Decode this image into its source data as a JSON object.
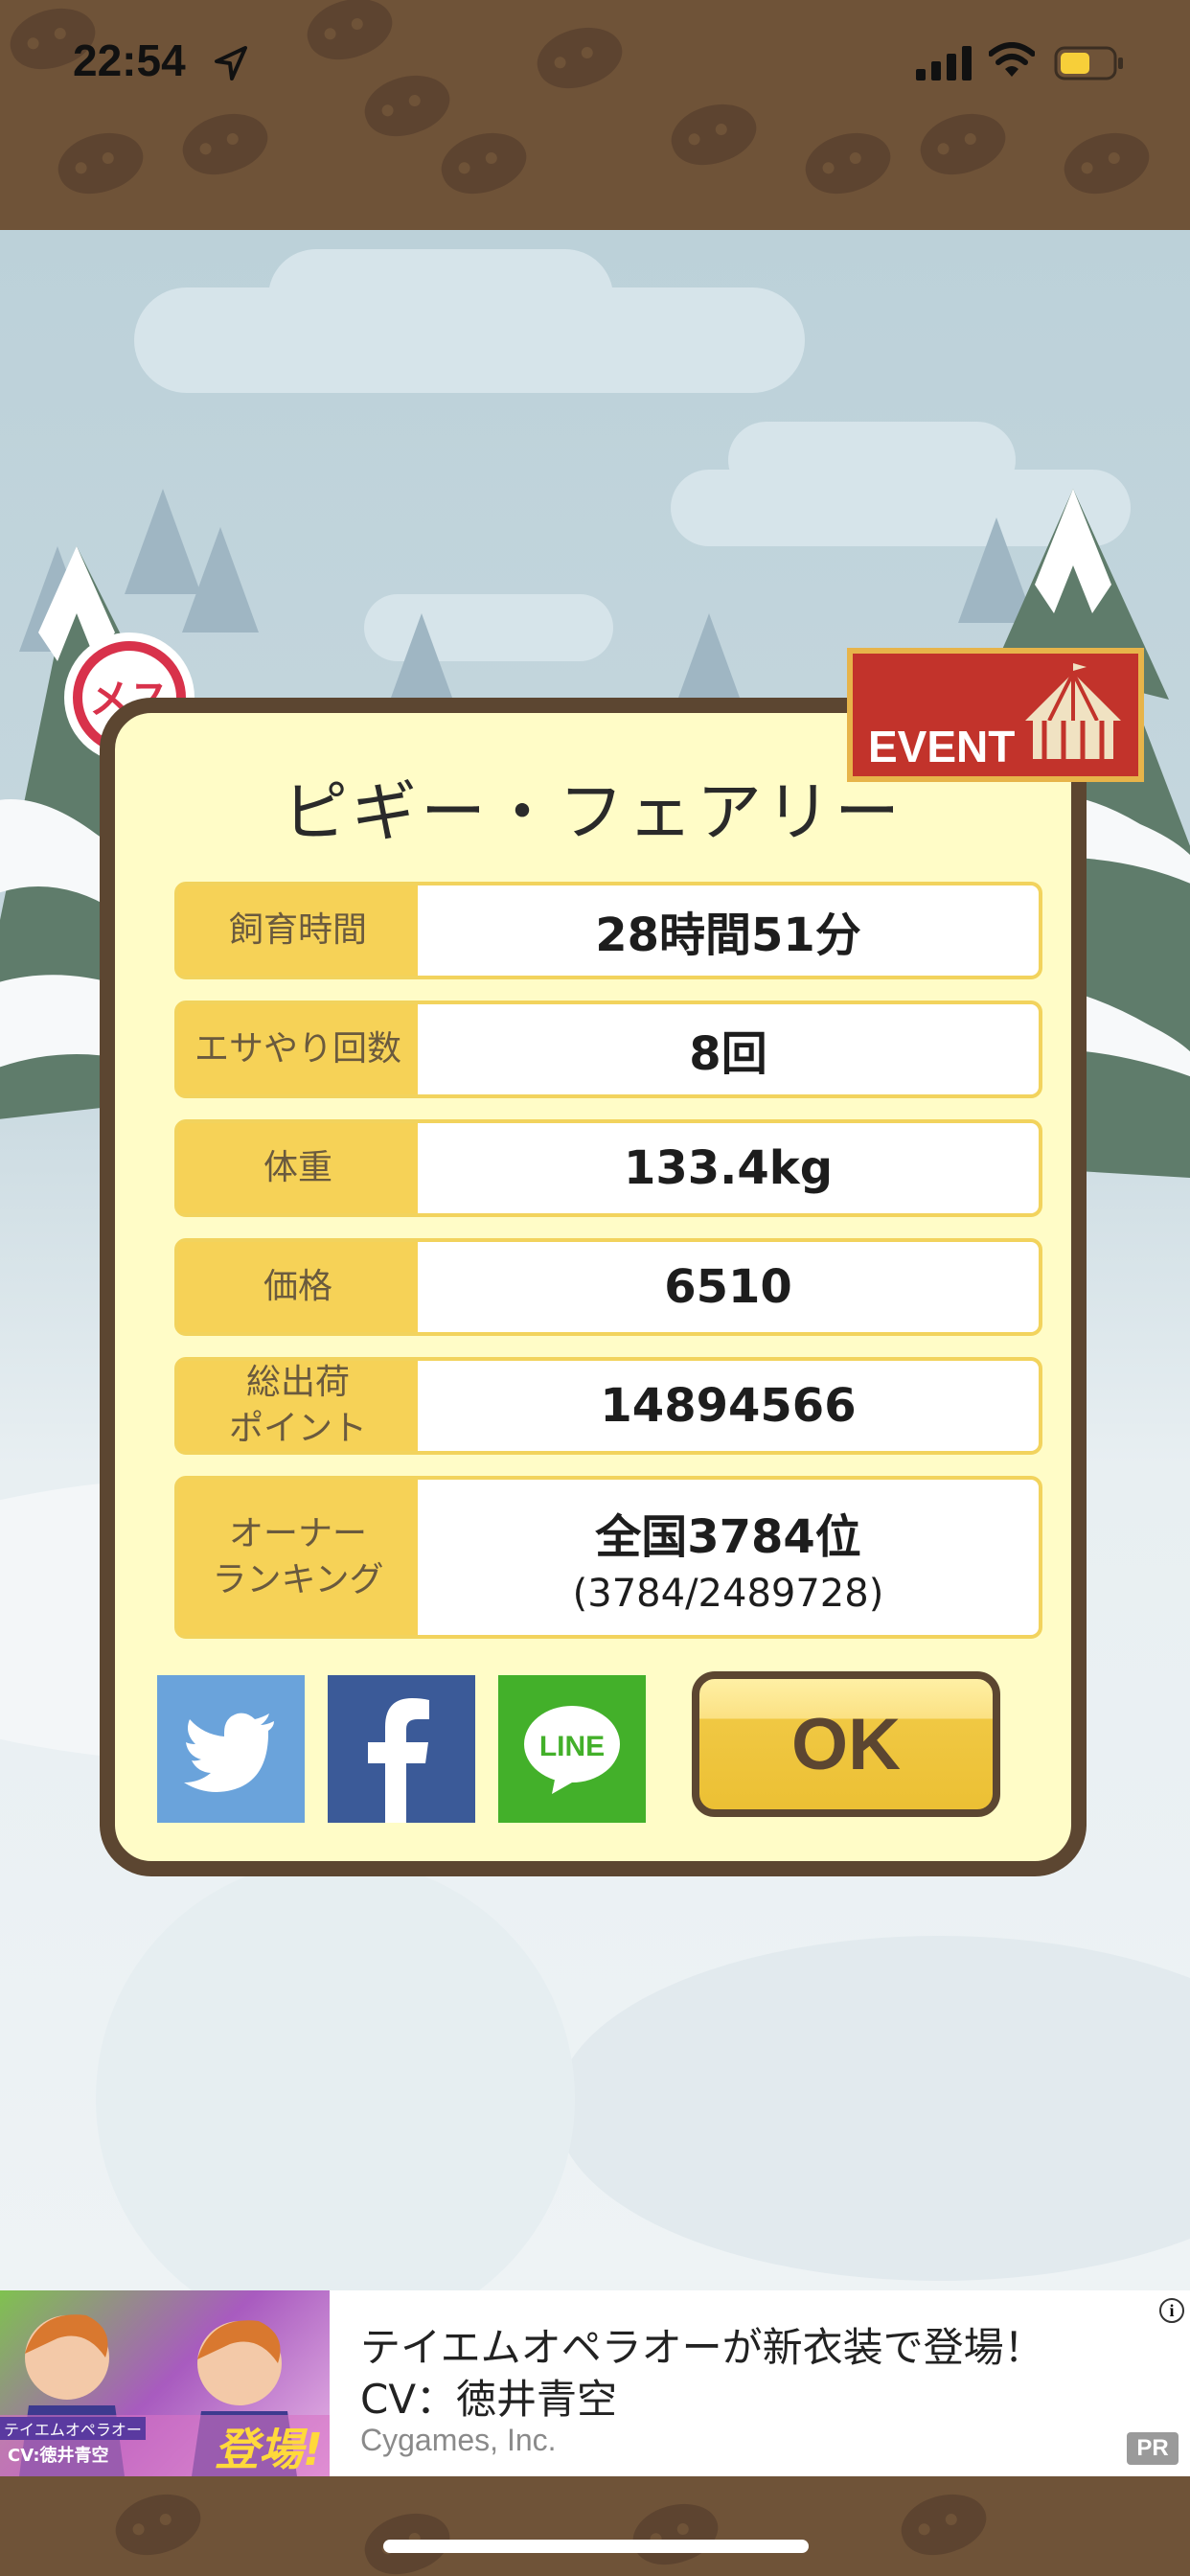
{
  "status_bar": {
    "time": "22:54",
    "location_icon": "location-arrow-icon",
    "signal_icon": "cellular-signal-icon",
    "wifi_icon": "wifi-icon",
    "battery_icon": "battery-icon"
  },
  "dialog": {
    "title": "ピギー・フェアリー",
    "gender_badge": "メス",
    "event_badge": "EVENT",
    "rows": [
      {
        "label": "飼育時間",
        "value": "28時間51分"
      },
      {
        "label": "エサやり回数",
        "value": "8回"
      },
      {
        "label": "体重",
        "value": "133.4kg"
      },
      {
        "label": "価格",
        "value": "6510"
      },
      {
        "label_line1": "総出荷",
        "label_line2": "ポイント",
        "value": "14894566"
      },
      {
        "label_line1": "オーナー",
        "label_line2": "ランキング",
        "value": "全国3784位",
        "sub_value": "(3784/2489728)"
      }
    ],
    "share_buttons": {
      "twitter_icon": "twitter-icon",
      "facebook_icon": "facebook-icon",
      "line_label": "LINE"
    },
    "ok_label": "OK"
  },
  "ad": {
    "title": "テイエムオペラオーが新衣装で登場！",
    "cv": "CV：徳井青空",
    "company": "Cygames, Inc.",
    "pr_label": "PR",
    "info_label": "i",
    "image_text": "登場!",
    "image_caption": "CV:徳井青空",
    "image_title": "テイエムオペラオー"
  },
  "colors": {
    "brown": "#5c4631",
    "dialog_bg": "#fffcc7",
    "label_yellow": "#f6d257",
    "twitter": "#6aa3db",
    "facebook": "#3b5a98",
    "line": "#43b02a",
    "event_red": "#c2332b"
  }
}
